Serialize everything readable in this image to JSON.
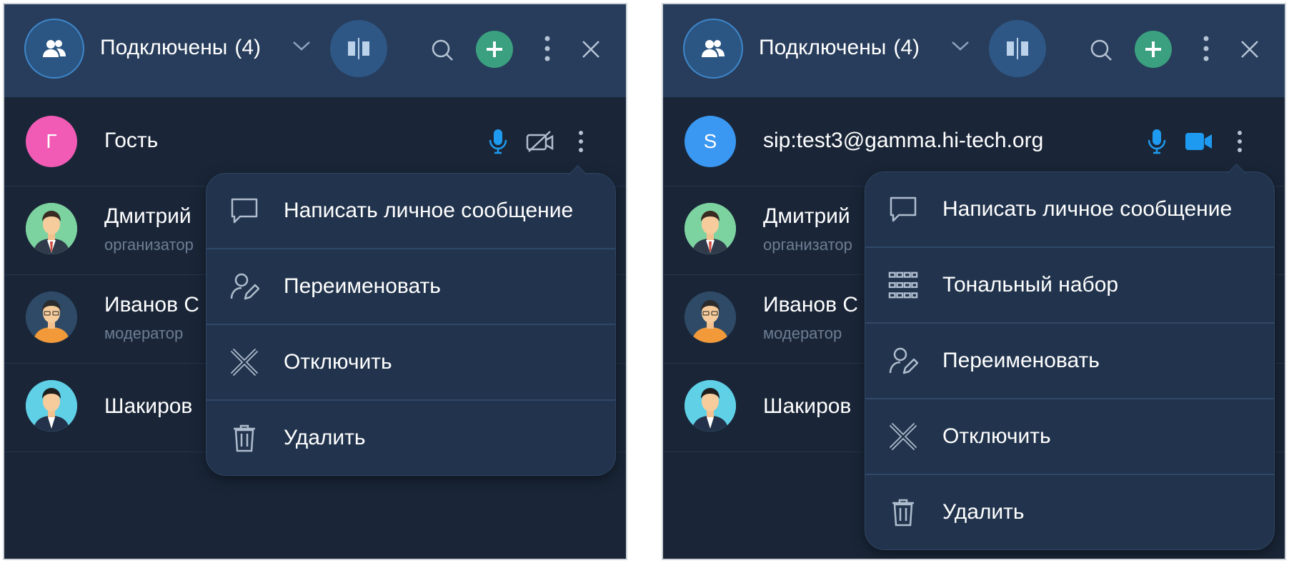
{
  "panels": [
    {
      "header": {
        "title": "Подключены",
        "count": "(4)"
      },
      "rows": [
        {
          "name": "Гость",
          "initial": "Г",
          "avatar_color": "#f15bb5"
        },
        {
          "name": "Дмитрий",
          "role": "организатор"
        },
        {
          "name": "Иванов С",
          "role": "модератор"
        },
        {
          "name": "Шакиров"
        }
      ],
      "menu": [
        {
          "label": "Написать личное сообщение",
          "icon": "chat-bubble-icon"
        },
        {
          "label": "Переименовать",
          "icon": "user-edit-icon"
        },
        {
          "label": "Отключить",
          "icon": "disconnect-x-icon"
        },
        {
          "label": "Удалить",
          "icon": "trash-icon"
        }
      ]
    },
    {
      "header": {
        "title": "Подключены",
        "count": "(4)"
      },
      "rows": [
        {
          "name": "sip:test3@gamma.hi-tech.org",
          "initial": "S",
          "avatar_color": "#3a97f2"
        },
        {
          "name": "Дмитрий",
          "role": "организатор"
        },
        {
          "name": "Иванов С",
          "role": "модератор"
        },
        {
          "name": "Шакиров"
        }
      ],
      "menu": [
        {
          "label": "Написать личное сообщение",
          "icon": "chat-bubble-icon"
        },
        {
          "label": "Тональный набор",
          "icon": "dialpad-icon"
        },
        {
          "label": "Переименовать",
          "icon": "user-edit-icon"
        },
        {
          "label": "Отключить",
          "icon": "disconnect-x-icon"
        },
        {
          "label": "Удалить",
          "icon": "trash-icon"
        }
      ]
    }
  ],
  "colors": {
    "accent_blue": "#1e9bf0",
    "add_green": "#3ba07f",
    "header_bg": "#273d5b",
    "panel_bg": "#1a2638"
  }
}
